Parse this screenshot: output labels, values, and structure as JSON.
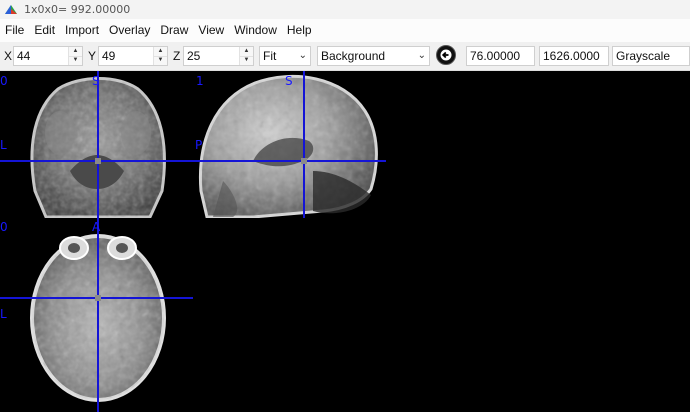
{
  "window": {
    "title": "1x0x0= 992.00000"
  },
  "menu": {
    "items": [
      "File",
      "Edit",
      "Import",
      "Overlay",
      "Draw",
      "View",
      "Window",
      "Help"
    ]
  },
  "toolbar": {
    "x_label": "X",
    "x_value": "44",
    "y_label": "Y",
    "y_value": "49",
    "z_label": "Z",
    "z_value": "25",
    "zoom_value": "Fit",
    "layer_value": "Background",
    "contrast_min": "76.00000",
    "contrast_max": "1626.0000",
    "colormap_value": "Grayscale"
  },
  "views": {
    "coronal": {
      "index": "0",
      "top_label": "S",
      "left_label": "L"
    },
    "sagittal": {
      "index": "1",
      "top_label": "S",
      "left_label": "P"
    },
    "axial": {
      "index": "0",
      "top_label": "A",
      "left_label": "L"
    }
  },
  "colors": {
    "crosshair": "#1414d6",
    "orientation_text": "#1818ff"
  }
}
